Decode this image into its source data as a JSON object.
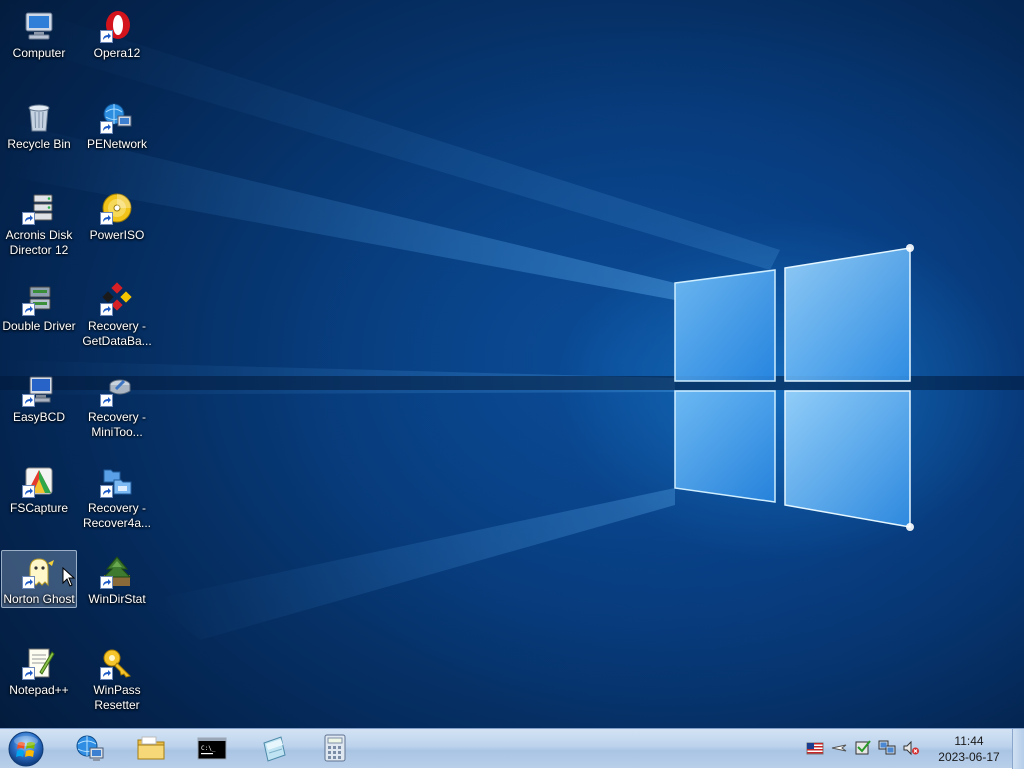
{
  "desktop": {
    "icons": [
      {
        "label": "Computer",
        "icon": "computer-icon"
      },
      {
        "label": "Recycle Bin",
        "icon": "recycle-bin-icon"
      },
      {
        "label": "Acronis Disk\nDirector 12",
        "icon": "acronis-icon"
      },
      {
        "label": "Double Driver",
        "icon": "double-driver-icon"
      },
      {
        "label": "EasyBCD",
        "icon": "easybcd-icon"
      },
      {
        "label": "FSCapture",
        "icon": "fscapture-icon"
      },
      {
        "label": "Norton Ghost",
        "icon": "norton-ghost-icon"
      },
      {
        "label": "Notepad++",
        "icon": "notepad-plus-plus-icon"
      },
      {
        "label": "Opera12",
        "icon": "opera-icon"
      },
      {
        "label": "PENetwork",
        "icon": "penetwork-icon"
      },
      {
        "label": "PowerISO",
        "icon": "poweriso-icon"
      },
      {
        "label": "Recovery -\nGetDataBa...",
        "icon": "recovery-getdataback-icon"
      },
      {
        "label": "Recovery -\nMiniToo...",
        "icon": "recovery-minitool-icon"
      },
      {
        "label": "Recovery -\nRecover4a...",
        "icon": "recovery-recover4all-icon"
      },
      {
        "label": "WinDirStat",
        "icon": "windirstat-icon"
      },
      {
        "label": "WinPass\nResetter",
        "icon": "winpass-resetter-icon"
      }
    ],
    "selected": "Norton Ghost"
  },
  "taskbar": {
    "start": "start-orb-icon",
    "pinned": [
      "network-globe-icon",
      "folder-icon",
      "command-prompt-icon",
      "notepad-icon",
      "calculator-icon"
    ],
    "tray": [
      "us-flag-icon",
      "arrow-icon",
      "device-icon",
      "network-icon",
      "volume-muted-icon"
    ],
    "clock": {
      "time": "11:44",
      "date": "2023-06-17"
    }
  }
}
